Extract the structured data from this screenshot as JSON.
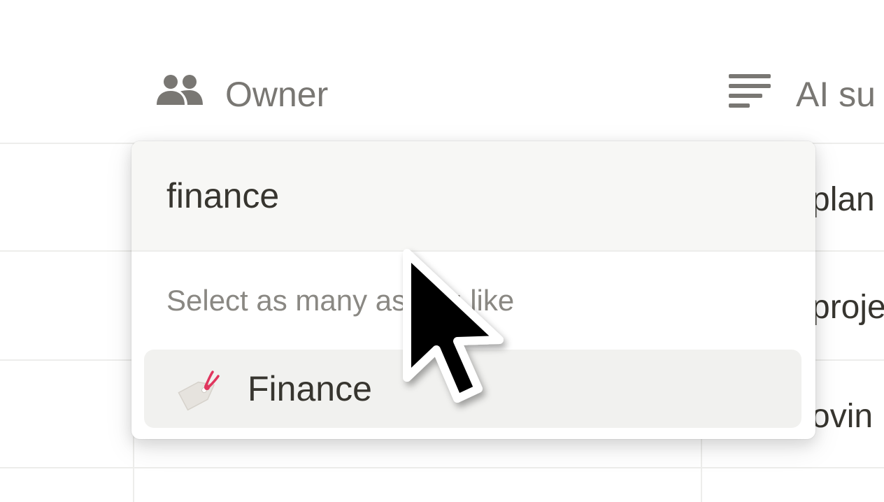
{
  "header": {
    "owner_label": "Owner",
    "owner_icon": "people-icon",
    "ai_label": "AI su",
    "ai_icon": "text-lines-icon"
  },
  "table": {
    "right_cells": [
      "plan",
      "proje",
      "ovin"
    ]
  },
  "owner_picker": {
    "search_value": "finance",
    "hint": "Select as many as you like",
    "options": [
      {
        "label": "Finance",
        "icon": "price-tag-icon"
      }
    ]
  },
  "colors": {
    "header_text": "#797773",
    "body_text": "#37352f",
    "hint_text": "#8a8883",
    "search_bg": "#f7f7f5",
    "option_hover_bg": "#f1f1ef",
    "tag_accent": "#e0365e"
  },
  "pointer": "arrow-cursor"
}
